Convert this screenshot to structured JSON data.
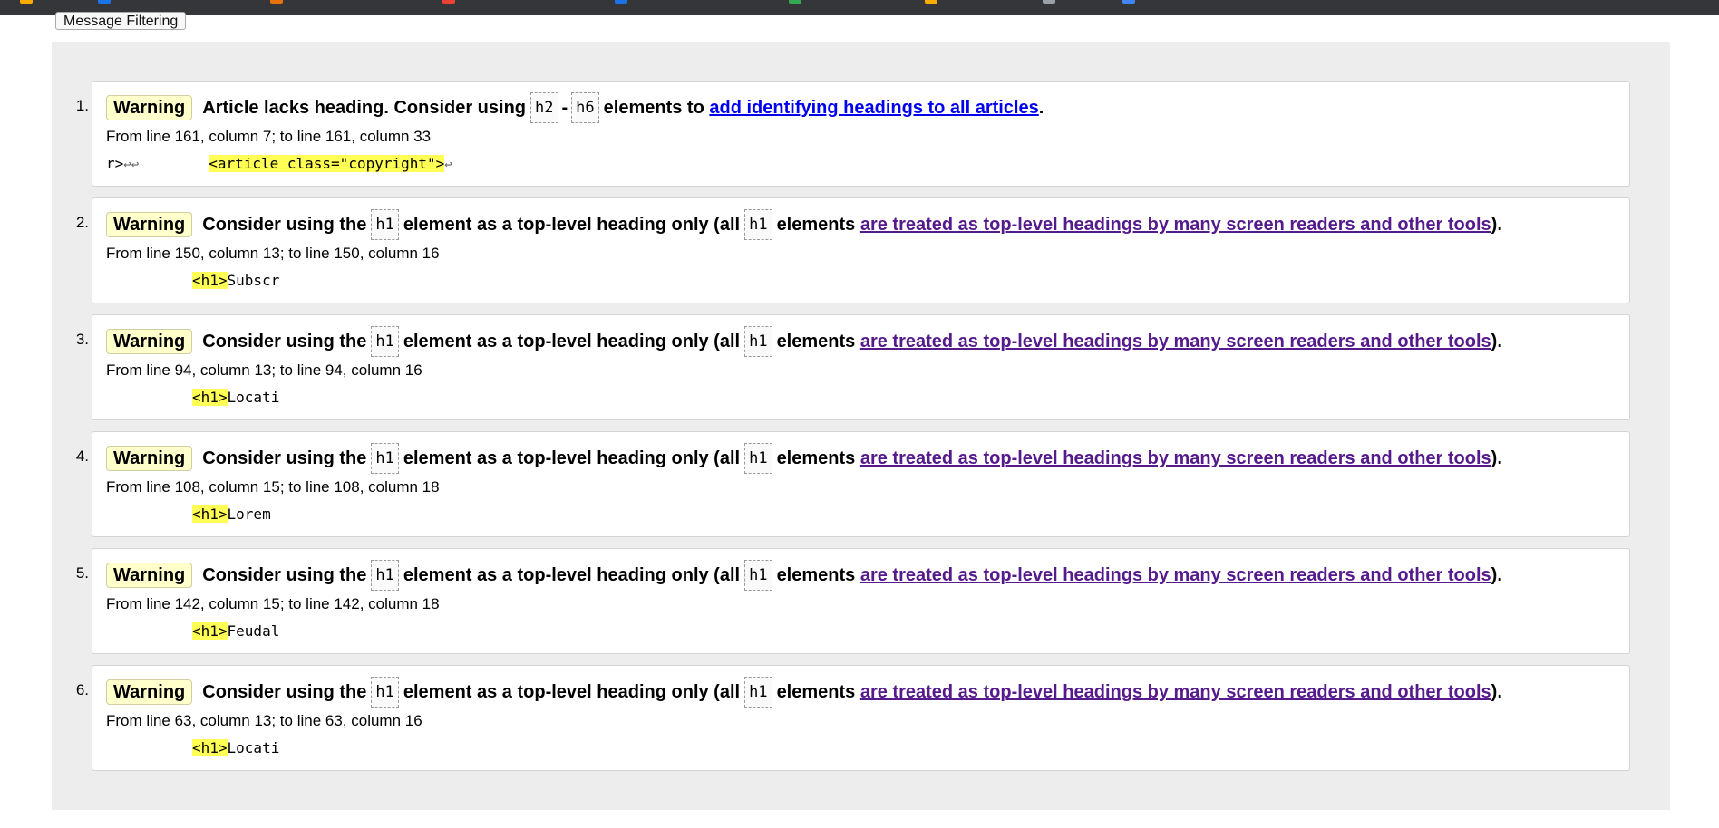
{
  "browser": {
    "toolbar_colors": [
      "#f9ab00",
      "#1a73e8",
      "#e8710a",
      "#ea4335",
      "#1a73e8",
      "#34a853",
      "#f9ab00",
      "#9aa0a6",
      "#4285f4"
    ]
  },
  "filter_button": {
    "label": "Message Filtering"
  },
  "messages": [
    {
      "number": "1.",
      "badge": "Warning",
      "text1": "Article lacks heading. Consider using",
      "code1": "h2",
      "sep": "-",
      "code2": "h6",
      "text2": "elements to",
      "link": "add identifying headings to all articles",
      "text3": ".",
      "location": "From line 161, column 7; to line 161, column 33",
      "extract_pre": "r>",
      "extract_lf1": "↩↩",
      "extract_gap": "        ",
      "extract_hl": "<article class=\"copyright\">",
      "extract_lf2": "↩"
    },
    {
      "number": "2.",
      "badge": "Warning",
      "text1": "Consider using the",
      "code1": "h1",
      "text2": "element as a top-level heading only (all",
      "code2": "h1",
      "text3": "elements",
      "link": "are treated as top-level headings by many screen readers and other tools",
      "text4": ").",
      "location": "From line 150, column 13; to line 150, column 16",
      "extract_hl": "<h1>",
      "extract_post": "Subscr"
    },
    {
      "number": "3.",
      "badge": "Warning",
      "text1": "Consider using the",
      "code1": "h1",
      "text2": "element as a top-level heading only (all",
      "code2": "h1",
      "text3": "elements",
      "link": "are treated as top-level headings by many screen readers and other tools",
      "text4": ").",
      "location": "From line 94, column 13; to line 94, column 16",
      "extract_hl": "<h1>",
      "extract_post": "Locati"
    },
    {
      "number": "4.",
      "badge": "Warning",
      "text1": "Consider using the",
      "code1": "h1",
      "text2": "element as a top-level heading only (all",
      "code2": "h1",
      "text3": "elements",
      "link": "are treated as top-level headings by many screen readers and other tools",
      "text4": ").",
      "location": "From line 108, column 15; to line 108, column 18",
      "extract_hl": "<h1>",
      "extract_post": "Lorem"
    },
    {
      "number": "5.",
      "badge": "Warning",
      "text1": "Consider using the",
      "code1": "h1",
      "text2": "element as a top-level heading only (all",
      "code2": "h1",
      "text3": "elements",
      "link": "are treated as top-level headings by many screen readers and other tools",
      "text4": ").",
      "location": "From line 142, column 15; to line 142, column 18",
      "extract_hl": "<h1>",
      "extract_post": "Feudal"
    },
    {
      "number": "6.",
      "badge": "Warning",
      "text1": "Consider using the",
      "code1": "h1",
      "text2": "element as a top-level heading only (all",
      "code2": "h1",
      "text3": "elements",
      "link": "are treated as top-level headings by many screen readers and other tools",
      "text4": ").",
      "location": "From line 63, column 13; to line 63, column 16",
      "extract_hl": "<h1>",
      "extract_post": "Locati"
    }
  ]
}
